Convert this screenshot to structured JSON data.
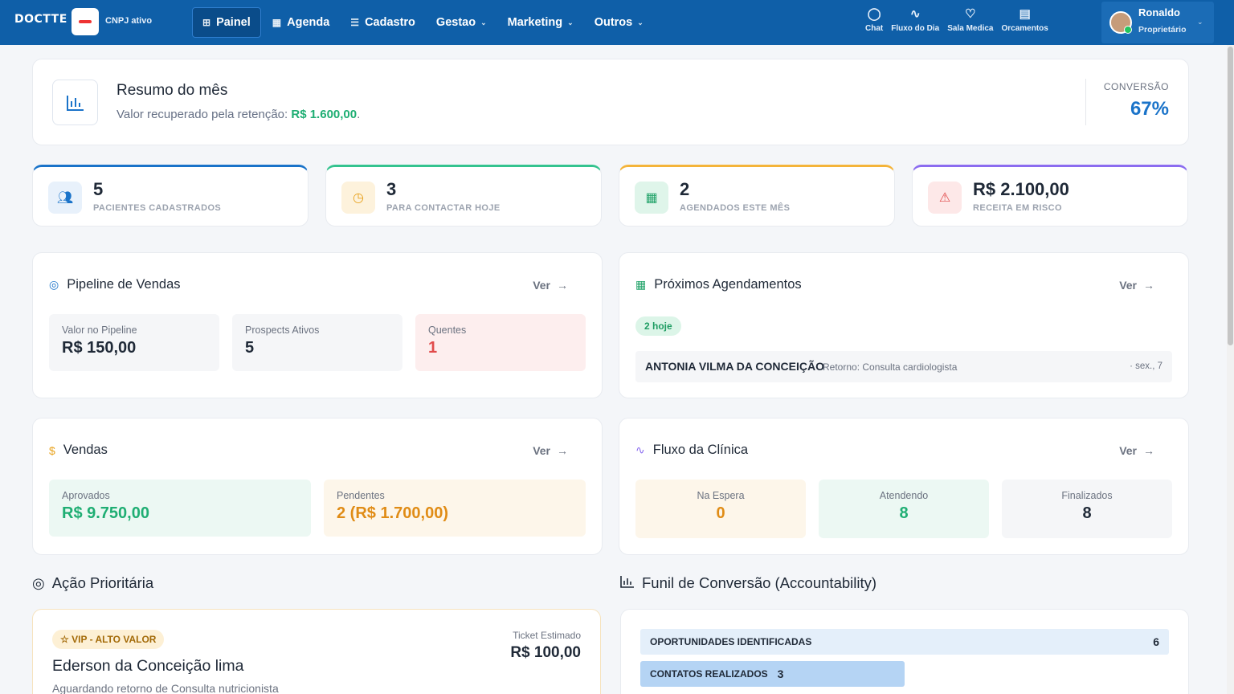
{
  "brand": {
    "logo_text": "DOCTTE",
    "cnpj_status": "CNPJ ativo"
  },
  "nav": [
    {
      "label": "Painel",
      "icon": "grid-icon"
    },
    {
      "label": "Agenda",
      "icon": "calendar-icon"
    },
    {
      "label": "Cadastro",
      "icon": "database-icon"
    },
    {
      "label": "Gestao",
      "icon": "chevron-down-icon"
    },
    {
      "label": "Marketing",
      "icon": "chevron-down-icon"
    },
    {
      "label": "Outros",
      "icon": "chevron-down-icon"
    }
  ],
  "shortcuts": [
    {
      "label": "Chat",
      "icon": "chat-icon"
    },
    {
      "label": "Fluxo do Dia",
      "icon": "activity-icon"
    },
    {
      "label": "Sala Medica",
      "icon": "stethoscope-icon"
    },
    {
      "label": "Orcamentos",
      "icon": "document-icon"
    }
  ],
  "user": {
    "name": "Ronaldo",
    "role": "Proprietário"
  },
  "summary": {
    "title": "Resumo do mês",
    "subtitle": "Valor recuperado pela retenção:",
    "amount": "R$ 1.600,00",
    "suffix": ".",
    "conversion_label": "CONVERSÃO",
    "conversion_value": "67%"
  },
  "stats": [
    {
      "value": "5",
      "label": "PACIENTES CADASTRADOS",
      "color": "#1a73c9",
      "icon": "users-icon"
    },
    {
      "value": "3",
      "label": "PARA CONTACTAR HOJE",
      "color": "#34c38f",
      "icon": "clock-icon"
    },
    {
      "value": "2",
      "label": "AGENDADOS ESTE MÊS",
      "color": "#f4b43a",
      "icon": "calendar-check-icon"
    },
    {
      "value": "R$ 2.100,00",
      "label": "RECEITA EM RISCO",
      "color": "#8b6cf0",
      "icon": "alert-icon"
    }
  ],
  "pipeline": {
    "title": "Pipeline de Vendas",
    "link": "Ver",
    "boxes": [
      {
        "label": "Valor no Pipeline",
        "value": "R$ 150,00"
      },
      {
        "label": "Prospects Ativos",
        "value": "5"
      },
      {
        "label": "Quentes",
        "value": "1"
      }
    ]
  },
  "appointments": {
    "title": "Próximos Agendamentos",
    "link": "Ver",
    "badge": "2 hoje",
    "items": [
      {
        "name": "ANTONIA VILMA DA CONCEIÇÃO",
        "desc": "Retorno: Consulta cardiologista",
        "date": "· sex., 7"
      }
    ]
  },
  "sales": {
    "title": "Vendas",
    "link": "Ver",
    "approved_label": "Aprovados",
    "approved_value": "R$ 9.750,00",
    "pending_label": "Pendentes",
    "pending_value": "2 (R$ 1.700,00)"
  },
  "flow": {
    "title": "Fluxo da Clínica",
    "link": "Ver",
    "boxes": [
      {
        "label": "Na Espera",
        "value": "0"
      },
      {
        "label": "Atendendo",
        "value": "8"
      },
      {
        "label": "Finalizados",
        "value": "8"
      }
    ]
  },
  "priority": {
    "section_title": "Ação Prioritária",
    "badge": "VIP - ALTO VALOR",
    "name": "Ederson da Conceição lima",
    "subtitle": "Aguardando retorno de Consulta nutricionista",
    "ticket_label": "Ticket Estimado",
    "ticket_value": "R$ 100,00"
  },
  "funnel": {
    "section_title": "Funil de Conversão (Accountability)",
    "stages": [
      {
        "label": "OPORTUNIDADES IDENTIFICADAS",
        "value": "6"
      },
      {
        "label": "CONTATOS REALIZADOS",
        "value": "3"
      }
    ]
  }
}
